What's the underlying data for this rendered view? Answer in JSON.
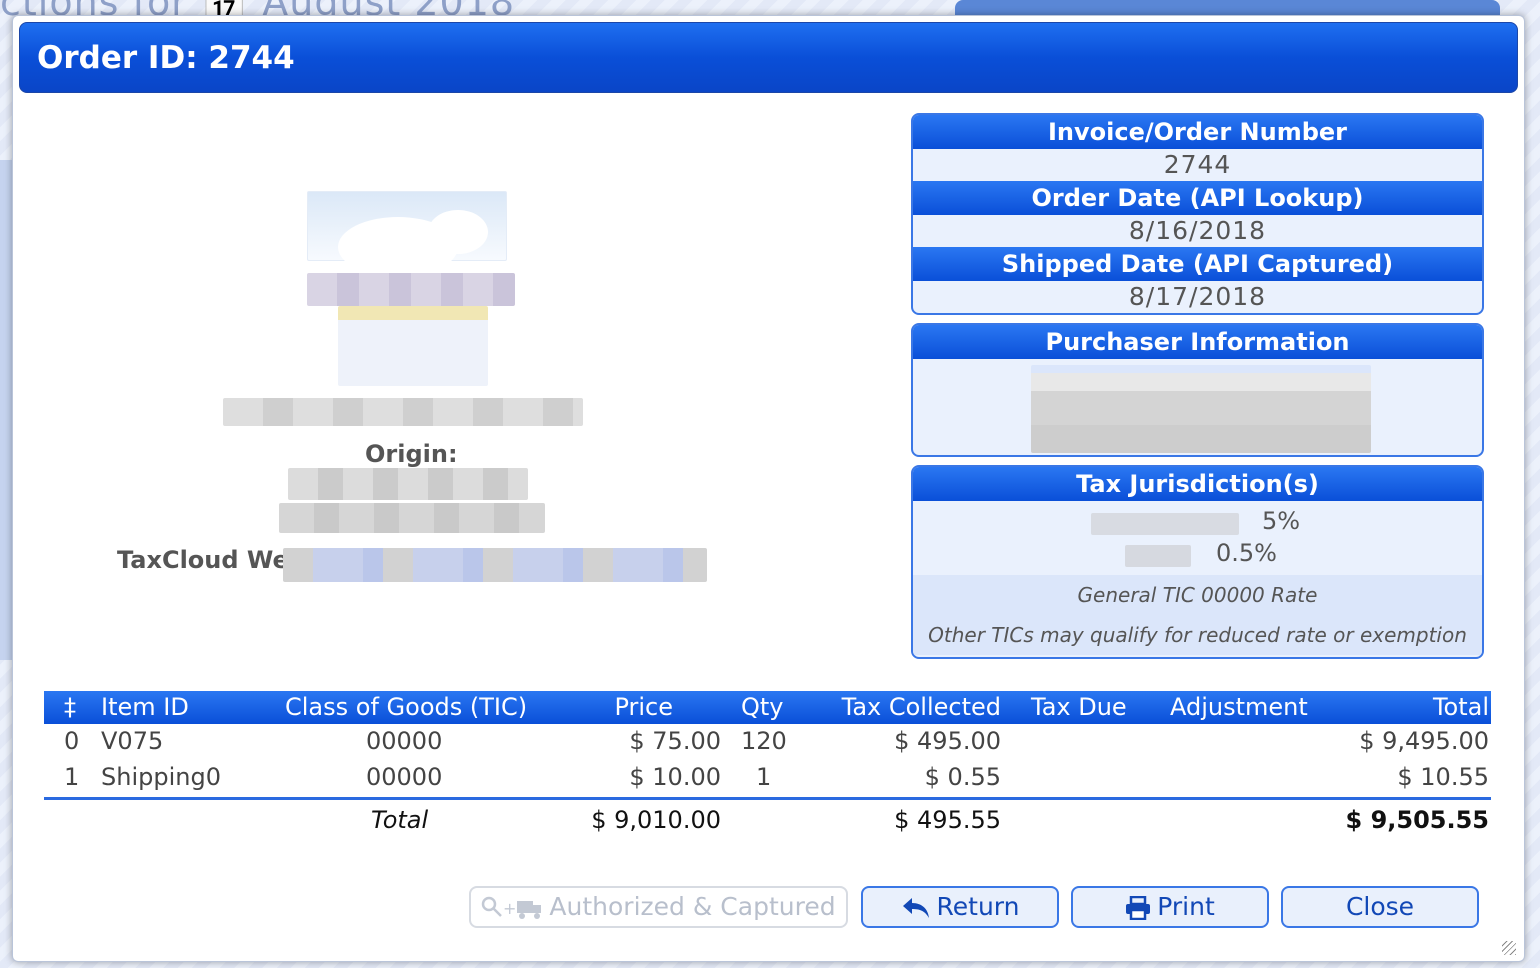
{
  "background": {
    "page_title": "ctions for 📅 August   2018"
  },
  "dialog": {
    "title": "Order ID: 2744",
    "origin_label": "Origin:",
    "website_label": "TaxCloud We",
    "invoice": {
      "header": "Invoice/Order Number",
      "value": "2744"
    },
    "order_date": {
      "header": "Order Date (API Lookup)",
      "value": "8/16/2018"
    },
    "shipped_date": {
      "header": "Shipped Date (API Captured)",
      "value": "8/17/2018"
    },
    "purchaser": {
      "header": "Purchaser Information"
    },
    "tax": {
      "header": "Tax Jurisdiction(s)",
      "rates": [
        "5%",
        "0.5%"
      ],
      "note1": "General TIC 00000 Rate",
      "note2": "Other TICs may qualify for reduced rate or exemption"
    },
    "table": {
      "headers": {
        "index": "‡",
        "item_id": "Item ID",
        "tic": "Class of Goods (TIC)",
        "price": "Price",
        "qty": "Qty",
        "tax_collected": "Tax Collected",
        "tax_due": "Tax Due",
        "adjustment": "Adjustment",
        "total": "Total"
      },
      "rows": [
        {
          "index": "0",
          "item_id": "V075",
          "tic": "00000",
          "price": "$ 75.00",
          "qty": "120",
          "tax_collected": "$ 495.00",
          "tax_due": "",
          "adjustment": "",
          "total": "$ 9,495.00"
        },
        {
          "index": "1",
          "item_id": "Shipping0",
          "tic": "00000",
          "price": "$ 10.00",
          "qty": "1",
          "tax_collected": "$ 0.55",
          "tax_due": "",
          "adjustment": "",
          "total": "$ 10.55"
        }
      ],
      "footer": {
        "label": "Total",
        "price": "$ 9,010.00",
        "tax_collected": "$ 495.55",
        "total": "$ 9,505.55"
      }
    },
    "buttons": {
      "status": "Authorized & Captured",
      "return": "Return",
      "print": "Print",
      "close": "Close"
    }
  },
  "colors": {
    "accent": "#0a4fd8",
    "panel_bg": "#eaf1fd",
    "button_text": "#1248b6"
  }
}
